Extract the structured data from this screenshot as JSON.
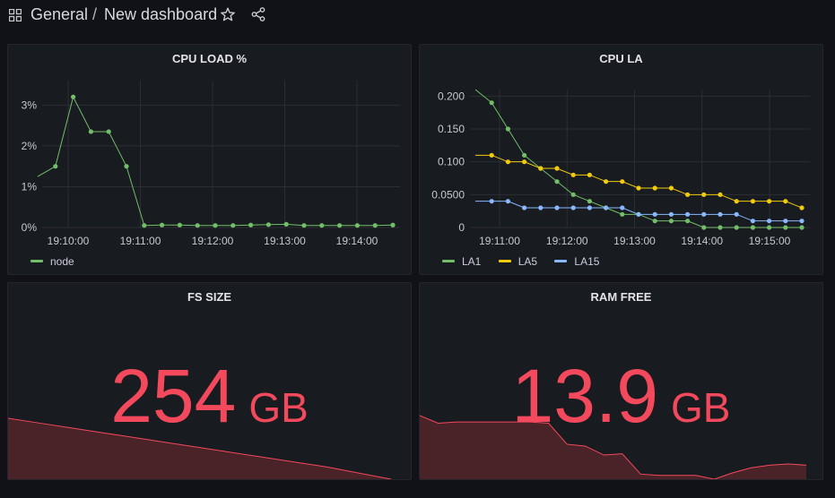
{
  "header": {
    "folder": "General",
    "separator": "/",
    "title": "New dashboard"
  },
  "colors": {
    "green": "#73bf69",
    "yellow": "#f2cc0c",
    "blue": "#8ab8ff",
    "red": "#f2495c",
    "panel_bg": "#181b1f"
  },
  "panels": {
    "cpu_load": {
      "title": "CPU LOAD %",
      "legend": [
        {
          "name": "node",
          "color": "#73bf69"
        }
      ]
    },
    "cpu_la": {
      "title": "CPU LA",
      "legend": [
        {
          "name": "LA1",
          "color": "#73bf69"
        },
        {
          "name": "LA5",
          "color": "#f2cc0c"
        },
        {
          "name": "LA15",
          "color": "#8ab8ff"
        }
      ]
    },
    "fs_size": {
      "title": "FS SIZE",
      "value": "254",
      "unit": "GB"
    },
    "ram_free": {
      "title": "RAM FREE",
      "value": "13.9",
      "unit": "GB"
    }
  },
  "chart_data": [
    {
      "id": "cpu_load",
      "type": "line",
      "title": "CPU LOAD %",
      "x_ticks": [
        "19:10:00",
        "19:11:00",
        "19:12:00",
        "19:13:00",
        "19:14:00"
      ],
      "y_ticks": [
        "0%",
        "1%",
        "2%",
        "3%"
      ],
      "ylim": [
        0,
        3.6
      ],
      "series": [
        {
          "name": "node",
          "color": "#73bf69",
          "values": [
            1.25,
            1.5,
            3.2,
            2.35,
            2.35,
            1.5,
            0.05,
            0.06,
            0.06,
            0.05,
            0.05,
            0.05,
            0.06,
            0.07,
            0.08,
            0.05,
            0.05,
            0.05,
            0.05,
            0.05,
            0.06
          ]
        }
      ]
    },
    {
      "id": "cpu_la",
      "type": "line",
      "title": "CPU LA",
      "x_ticks": [
        "19:11:00",
        "19:12:00",
        "19:13:00",
        "19:14:00",
        "19:15:00"
      ],
      "y_ticks": [
        "0",
        "0.0500",
        "0.100",
        "0.150",
        "0.200"
      ],
      "ylim": [
        0,
        0.21
      ],
      "series": [
        {
          "name": "LA1",
          "color": "#73bf69",
          "values": [
            0.21,
            0.19,
            0.15,
            0.11,
            0.09,
            0.07,
            0.05,
            0.04,
            0.03,
            0.02,
            0.02,
            0.01,
            0.01,
            0.01,
            0.0,
            0.0,
            0.0,
            0.0,
            0.0,
            0.0,
            0.0
          ]
        },
        {
          "name": "LA5",
          "color": "#f2cc0c",
          "values": [
            0.11,
            0.11,
            0.1,
            0.1,
            0.09,
            0.09,
            0.08,
            0.08,
            0.07,
            0.07,
            0.06,
            0.06,
            0.06,
            0.05,
            0.05,
            0.05,
            0.04,
            0.04,
            0.04,
            0.04,
            0.03
          ]
        },
        {
          "name": "LA15",
          "color": "#8ab8ff",
          "values": [
            0.04,
            0.04,
            0.04,
            0.03,
            0.03,
            0.03,
            0.03,
            0.03,
            0.03,
            0.03,
            0.02,
            0.02,
            0.02,
            0.02,
            0.02,
            0.02,
            0.02,
            0.01,
            0.01,
            0.01,
            0.01
          ]
        }
      ]
    },
    {
      "id": "fs_size",
      "type": "area",
      "title": "FS SIZE",
      "values": [
        1.0,
        0.92,
        0.84,
        0.76,
        0.68,
        0.6,
        0.52,
        0.44,
        0.36,
        0.28,
        0.2,
        0.1,
        0.0
      ]
    },
    {
      "id": "ram_free",
      "type": "area",
      "title": "RAM FREE",
      "values": [
        1.0,
        0.88,
        0.9,
        0.9,
        0.9,
        0.9,
        0.9,
        0.88,
        0.55,
        0.52,
        0.38,
        0.4,
        0.08,
        0.06,
        0.06,
        0.06,
        0.0,
        0.1,
        0.18,
        0.22,
        0.24,
        0.22
      ]
    }
  ]
}
